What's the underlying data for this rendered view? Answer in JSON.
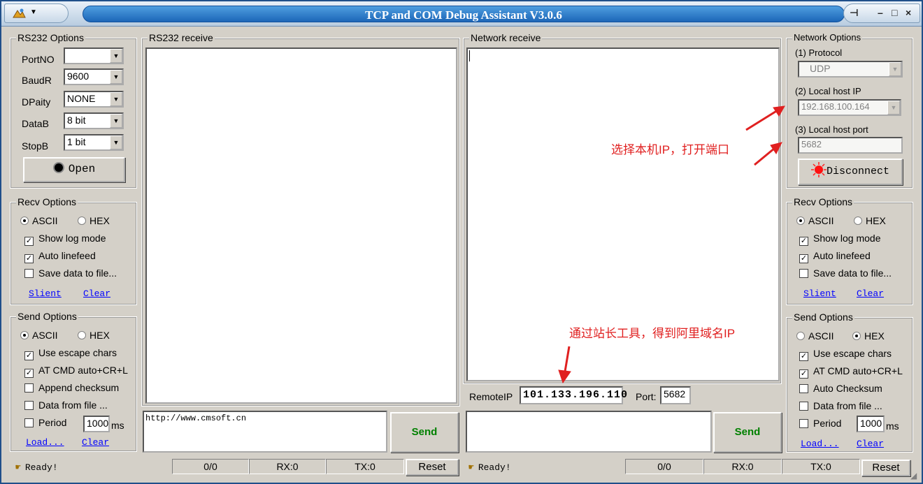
{
  "app": {
    "title": "TCP and COM Debug Assistant  V3.0.6",
    "window_buttons": {
      "pin": "⊣",
      "minimize": "–",
      "maximize": "□",
      "close": "×"
    }
  },
  "rs232_options": {
    "title": "RS232 Options",
    "port_label": "PortNO",
    "port_value": "",
    "baud_label": "BaudR",
    "baud_value": "9600",
    "parity_label": "DPaity",
    "parity_value": "NONE",
    "databits_label": "DataB",
    "databits_value": "8 bit",
    "stopbits_label": "StopB",
    "stopbits_value": "1 bit",
    "open_label": "Open"
  },
  "recv_left": {
    "title": "Recv Options",
    "ascii": "ASCII",
    "hex": "HEX",
    "show_log": "Show log mode",
    "auto_linefeed": "Auto linefeed",
    "save_data": "Save data to file...",
    "silent": "Slient",
    "clear": "Clear"
  },
  "send_left": {
    "title": "Send Options",
    "ascii": "ASCII",
    "hex": "HEX",
    "escape": "Use escape chars",
    "at_cmd": "AT CMD auto+CR+L",
    "append_checksum": "Append checksum",
    "data_from_file": "Data from file ...",
    "period": "Period",
    "period_value": "1000",
    "ms": "ms",
    "load": "Load...",
    "clear": "Clear"
  },
  "rs232_receive": {
    "title": "RS232 receive"
  },
  "network_receive": {
    "title": "Network receive"
  },
  "rs232_send": {
    "text": "http://www.cmsoft.cn",
    "send_label": "Send"
  },
  "network_send": {
    "text": "",
    "send_label": "Send"
  },
  "remote": {
    "ip_label": "RemoteIP",
    "ip_value": "101.133.196.110",
    "port_label": "Port:",
    "port_value": "5682"
  },
  "network_options": {
    "title": "Network Options",
    "protocol_label": "(1) Protocol",
    "protocol_value": "UDP",
    "local_ip_label": "(2) Local host IP",
    "local_ip_value": "192.168.100.164",
    "local_port_label": "(3) Local host port",
    "local_port_value": "5682",
    "disconnect_label": "Disconnect"
  },
  "recv_right": {
    "title": "Recv Options",
    "ascii": "ASCII",
    "hex": "HEX",
    "show_log": "Show log mode",
    "auto_linefeed": "Auto linefeed",
    "save_data": "Save data to file...",
    "silent": "Slient",
    "clear": "Clear"
  },
  "send_right": {
    "title": "Send Options",
    "ascii": "ASCII",
    "hex": "HEX",
    "escape": "Use escape chars",
    "at_cmd": "AT CMD auto+CR+L",
    "auto_checksum": "Auto Checksum",
    "data_from_file": "Data from file ...",
    "period": "Period",
    "period_value": "1000",
    "ms": "ms",
    "load": "Load...",
    "clear": "Clear"
  },
  "status_left": {
    "ready": "Ready!",
    "count": "0/0",
    "rx": "RX:0",
    "tx": "TX:0",
    "reset": "Reset"
  },
  "status_right": {
    "ready": "Ready!",
    "count": "0/0",
    "rx": "RX:0",
    "tx": "TX:0",
    "reset": "Reset"
  },
  "annotations": {
    "select_ip": "选择本机IP，打开端口",
    "get_ip": "通过站长工具，得到阿里域名IP"
  },
  "colors": {
    "annotation": "#e02020",
    "send_text": "#008000",
    "link": "#0000ff",
    "title_bar": "#1c66b8"
  }
}
